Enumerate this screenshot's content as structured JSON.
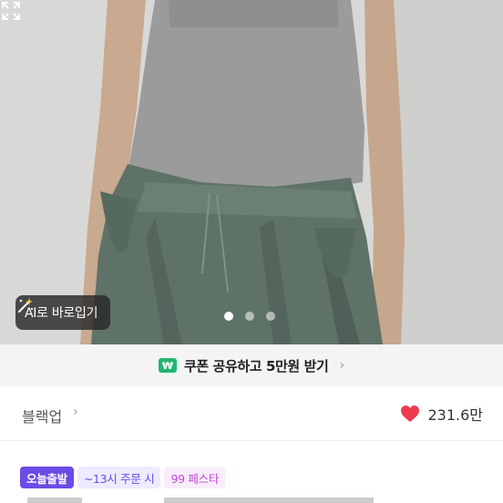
{
  "hero": {
    "ai_button_label": "AI로 바로입기",
    "pager": {
      "count": 3,
      "active_index": 0
    }
  },
  "coupon": {
    "icon_label": "₩",
    "text": "쿠폰 공유하고 5만원 받기",
    "chevron": "›"
  },
  "product": {
    "brand": "블랙업",
    "brand_chevron": "›",
    "like_count": "231.6만"
  },
  "badges": {
    "today": "오늘출발",
    "order_cutoff": "~13시 주문 시",
    "festa": "99 페스타"
  },
  "colors": {
    "accent": "#6b4ce6",
    "heart": "#ee3a4e",
    "coupon_icon": "#22b573"
  }
}
